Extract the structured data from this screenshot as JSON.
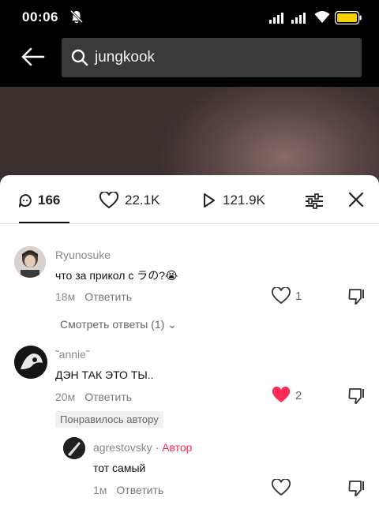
{
  "status": {
    "time": "00:06"
  },
  "search": {
    "query": "jungkook"
  },
  "tabs": {
    "comments": "166",
    "likes": "22.1K",
    "views": "121.9K"
  },
  "comments": [
    {
      "username": "Ryunosuke",
      "text": "что за прикол с ラの?😭",
      "time": "18м",
      "reply_label": "Ответить",
      "likes": "1",
      "liked": false,
      "view_replies": "Смотреть ответы (1) ⌄"
    },
    {
      "username": "˜annie˜",
      "text": "ДЭН ТАК ЭТО ТЫ..",
      "time": "20м",
      "reply_label": "Ответить",
      "likes": "2",
      "liked": true,
      "liked_by_author": "Понравилось автору"
    }
  ],
  "reply": {
    "username": "agrestovsky",
    "author_tag": "· Автор",
    "text": "тот самый",
    "time": "1м",
    "reply_label": "Ответить"
  },
  "colors": {
    "accent": "#fe2c55",
    "battery": "#f5d000"
  }
}
